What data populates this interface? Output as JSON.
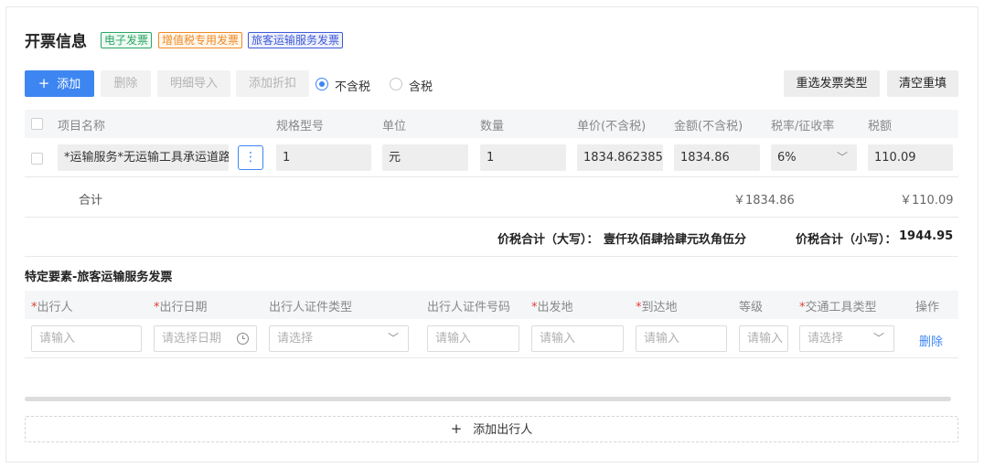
{
  "header": {
    "title": "开票信息",
    "tags": [
      {
        "label": "电子发票",
        "color": "#2aa564"
      },
      {
        "label": "增值税专用发票",
        "color": "#f08a24"
      },
      {
        "label": "旅客运输服务发票",
        "color": "#3f5bd8"
      }
    ]
  },
  "toolbar": {
    "add_label": "添加",
    "delete_label": "删除",
    "import_label": "明细导入",
    "discount_label": "添加折扣",
    "tax_options": [
      "不含税",
      "含税"
    ],
    "tax_selected": "不含税",
    "reselect_label": "重选发票类型",
    "clear_label": "清空重填"
  },
  "items_table": {
    "columns": [
      "项目名称",
      "规格型号",
      "单位",
      "数量",
      "单价(不含税)",
      "金额(不含税)",
      "税率/征收率",
      "税额"
    ],
    "row": {
      "name": "*运输服务*无运输工具承运道路",
      "spec": "1",
      "unit": "元",
      "qty": "1",
      "price": "1834.862385",
      "amount": "1834.86",
      "rate": "6%",
      "tax": "110.09"
    },
    "total_label": "合计",
    "total_amount": "￥1834.86",
    "total_tax": "￥110.09"
  },
  "summary": {
    "upper_label": "价税合计（大写）：",
    "upper_value": "壹仟玖佰肆拾肆元玖角伍分",
    "lower_label": "价税合计（小写）：",
    "lower_value": "1944.95"
  },
  "passenger": {
    "section_title": "特定要素-旅客运输服务发票",
    "columns": [
      {
        "label": "出行人",
        "required": "*"
      },
      {
        "label": "出行日期",
        "required": "*"
      },
      {
        "label": "出行人证件类型",
        "required": ""
      },
      {
        "label": "出行人证件号码",
        "required": ""
      },
      {
        "label": "出发地",
        "required": "*"
      },
      {
        "label": "到达地",
        "required": "*"
      },
      {
        "label": "等级",
        "required": ""
      },
      {
        "label": "交通工具类型",
        "required": "*"
      },
      {
        "label": "操作",
        "required": ""
      }
    ],
    "placeholders": {
      "traveler": "请输入",
      "date": "请选择日期",
      "id_type": "请选择",
      "id_number": "请输入",
      "departure": "请输入",
      "arrival": "请输入",
      "grade": "请输入",
      "vehicle": "请选择"
    },
    "delete_link": "删除",
    "add_button": "添加出行人"
  },
  "icons": {
    "plus": "plus-icon",
    "more": "more-vertical-icon",
    "chevron": "chevron-down-icon",
    "clock": "clock-icon"
  }
}
